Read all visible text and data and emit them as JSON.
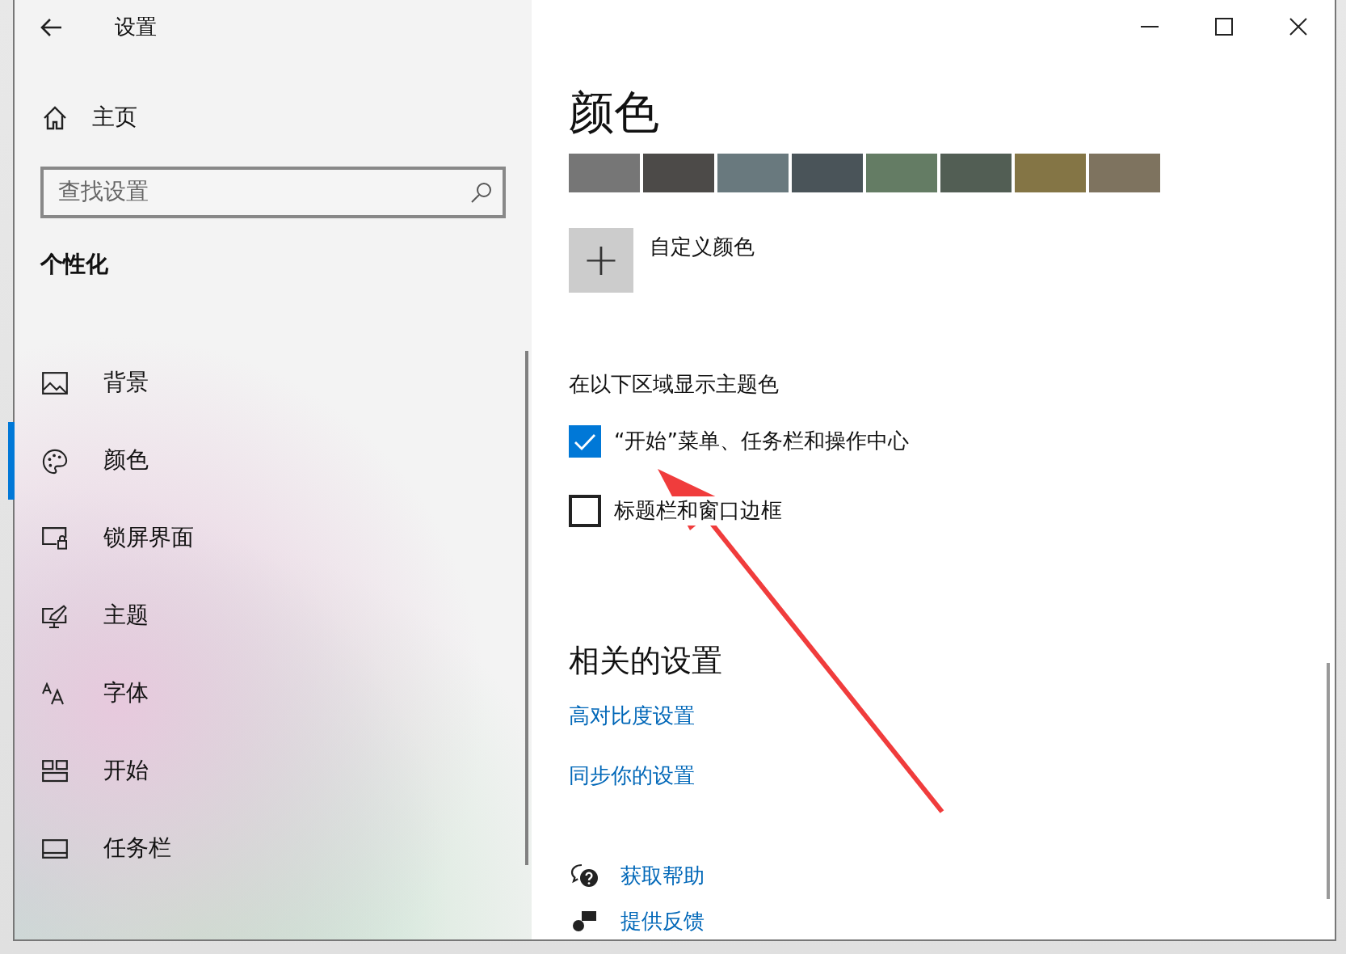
{
  "window": {
    "title": "设置"
  },
  "sidebar": {
    "home": "主页",
    "search": {
      "placeholder": "查找设置"
    },
    "section": "个性化",
    "items": [
      {
        "label": "背景",
        "selected": false
      },
      {
        "label": "颜色",
        "selected": true
      },
      {
        "label": "锁屏界面",
        "selected": false
      },
      {
        "label": "主题",
        "selected": false
      },
      {
        "label": "字体",
        "selected": false
      },
      {
        "label": "开始",
        "selected": false
      },
      {
        "label": "任务栏",
        "selected": false
      }
    ]
  },
  "content": {
    "heading": "颜色",
    "swatches": [
      {
        "color": "#767676"
      },
      {
        "color": "#4c4a48"
      },
      {
        "color": "#69797e"
      },
      {
        "color": "#4a5459"
      },
      {
        "color": "#647c64"
      },
      {
        "color": "#525e54"
      },
      {
        "color": "#847545"
      },
      {
        "color": "#7e735f"
      }
    ],
    "custom_color": {
      "icon": "+",
      "label": "自定义颜色"
    },
    "accent_label": "在以下区域显示主题色",
    "options": [
      {
        "label": "“开始”菜单、任务栏和操作中心",
        "checked": true
      },
      {
        "label": "标题栏和窗口边框",
        "checked": false
      }
    ],
    "related_heading": "相关的设置",
    "related_links": [
      "高对比度设置",
      "同步你的设置"
    ],
    "help_links": [
      {
        "kind": "help",
        "label": "获取帮助"
      },
      {
        "kind": "feedback",
        "label": "提供反馈"
      }
    ]
  }
}
